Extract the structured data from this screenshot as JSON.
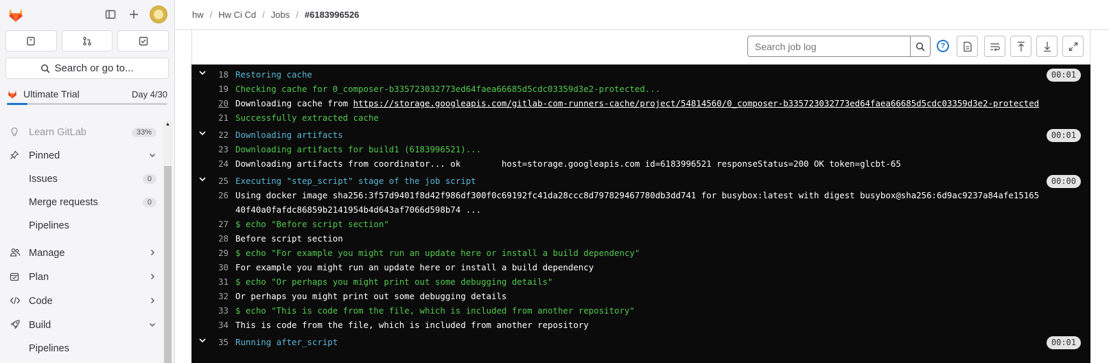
{
  "sidebar": {
    "tabs": [
      "issues",
      "merge-requests",
      "todos"
    ],
    "search_label": "Search or go to...",
    "trial": {
      "name": "Ultimate Trial",
      "day": "Day 4/30",
      "progress_pct": 13
    },
    "learn": {
      "label": "Learn GitLab",
      "badge": "33%"
    },
    "pinned": {
      "label": "Pinned",
      "items": [
        {
          "label": "Issues",
          "count": "0"
        },
        {
          "label": "Merge requests",
          "count": "0"
        },
        {
          "label": "Pipelines"
        }
      ]
    },
    "groups": [
      {
        "label": "Manage"
      },
      {
        "label": "Plan"
      },
      {
        "label": "Code"
      },
      {
        "label": "Build"
      }
    ],
    "build_sub": "Pipelines"
  },
  "breadcrumb": [
    "hw",
    "Hw Ci Cd",
    "Jobs",
    "#6183996526"
  ],
  "toolbar": {
    "search_placeholder": "Search job log"
  },
  "log": {
    "lines": [
      {
        "n": "18",
        "t": "Restoring cache",
        "c": "cyan",
        "section": true,
        "dur": "00:01"
      },
      {
        "n": "19",
        "t": "Checking cache for 0_composer-b335723032773ed64faea66685d5cdc03359d3e2-protected...",
        "c": "green"
      },
      {
        "n": "20",
        "t": "Downloading cache from ",
        "link": "https://storage.googleapis.com/gitlab-com-runners-cache/project/54814560/0_composer-b335723032773ed64faea66685d5cdc03359d3e2-protected",
        "c": "white"
      },
      {
        "n": "21",
        "t": "Successfully extracted cache",
        "c": "green"
      },
      {
        "n": "22",
        "t": "Downloading artifacts",
        "c": "cyan",
        "section": true,
        "dur": "00:01"
      },
      {
        "n": "23",
        "t": "Downloading artifacts for build1 (6183996521)...",
        "c": "green"
      },
      {
        "n": "24",
        "t": "Downloading artifacts from coordinator... ok        host=storage.googleapis.com id=6183996521 responseStatus=200 OK token=glcbt-65",
        "c": "white"
      },
      {
        "n": "25",
        "t": "Executing \"step_script\" stage of the job script",
        "c": "cyan",
        "section": true,
        "dur": "00:00"
      },
      {
        "n": "26",
        "t": "Using docker image sha256:3f57d9401f8d42f986df300f0c69192fc41da28ccc8d797829467780db3dd741 for busybox:latest with digest busybox@sha256:6d9ac9237a84afe1516540f40a0fafdc86859b2141954b4d643af7066d598b74 ...",
        "c": "white"
      },
      {
        "n": "27",
        "t": "$ echo \"Before script section\"",
        "c": "green"
      },
      {
        "n": "28",
        "t": "Before script section",
        "c": "white"
      },
      {
        "n": "29",
        "t": "$ echo \"For example you might run an update here or install a build dependency\"",
        "c": "green"
      },
      {
        "n": "30",
        "t": "For example you might run an update here or install a build dependency",
        "c": "white"
      },
      {
        "n": "31",
        "t": "$ echo \"Or perhaps you might print out some debugging details\"",
        "c": "green"
      },
      {
        "n": "32",
        "t": "Or perhaps you might print out some debugging details",
        "c": "white"
      },
      {
        "n": "33",
        "t": "$ echo \"This is code from the file, which is included from another repository\"",
        "c": "green"
      },
      {
        "n": "34",
        "t": "This is code from the file, which is included from another repository",
        "c": "white"
      },
      {
        "n": "35",
        "t": "Running after_script",
        "c": "cyan",
        "section": true,
        "dur": "00:01"
      }
    ]
  }
}
